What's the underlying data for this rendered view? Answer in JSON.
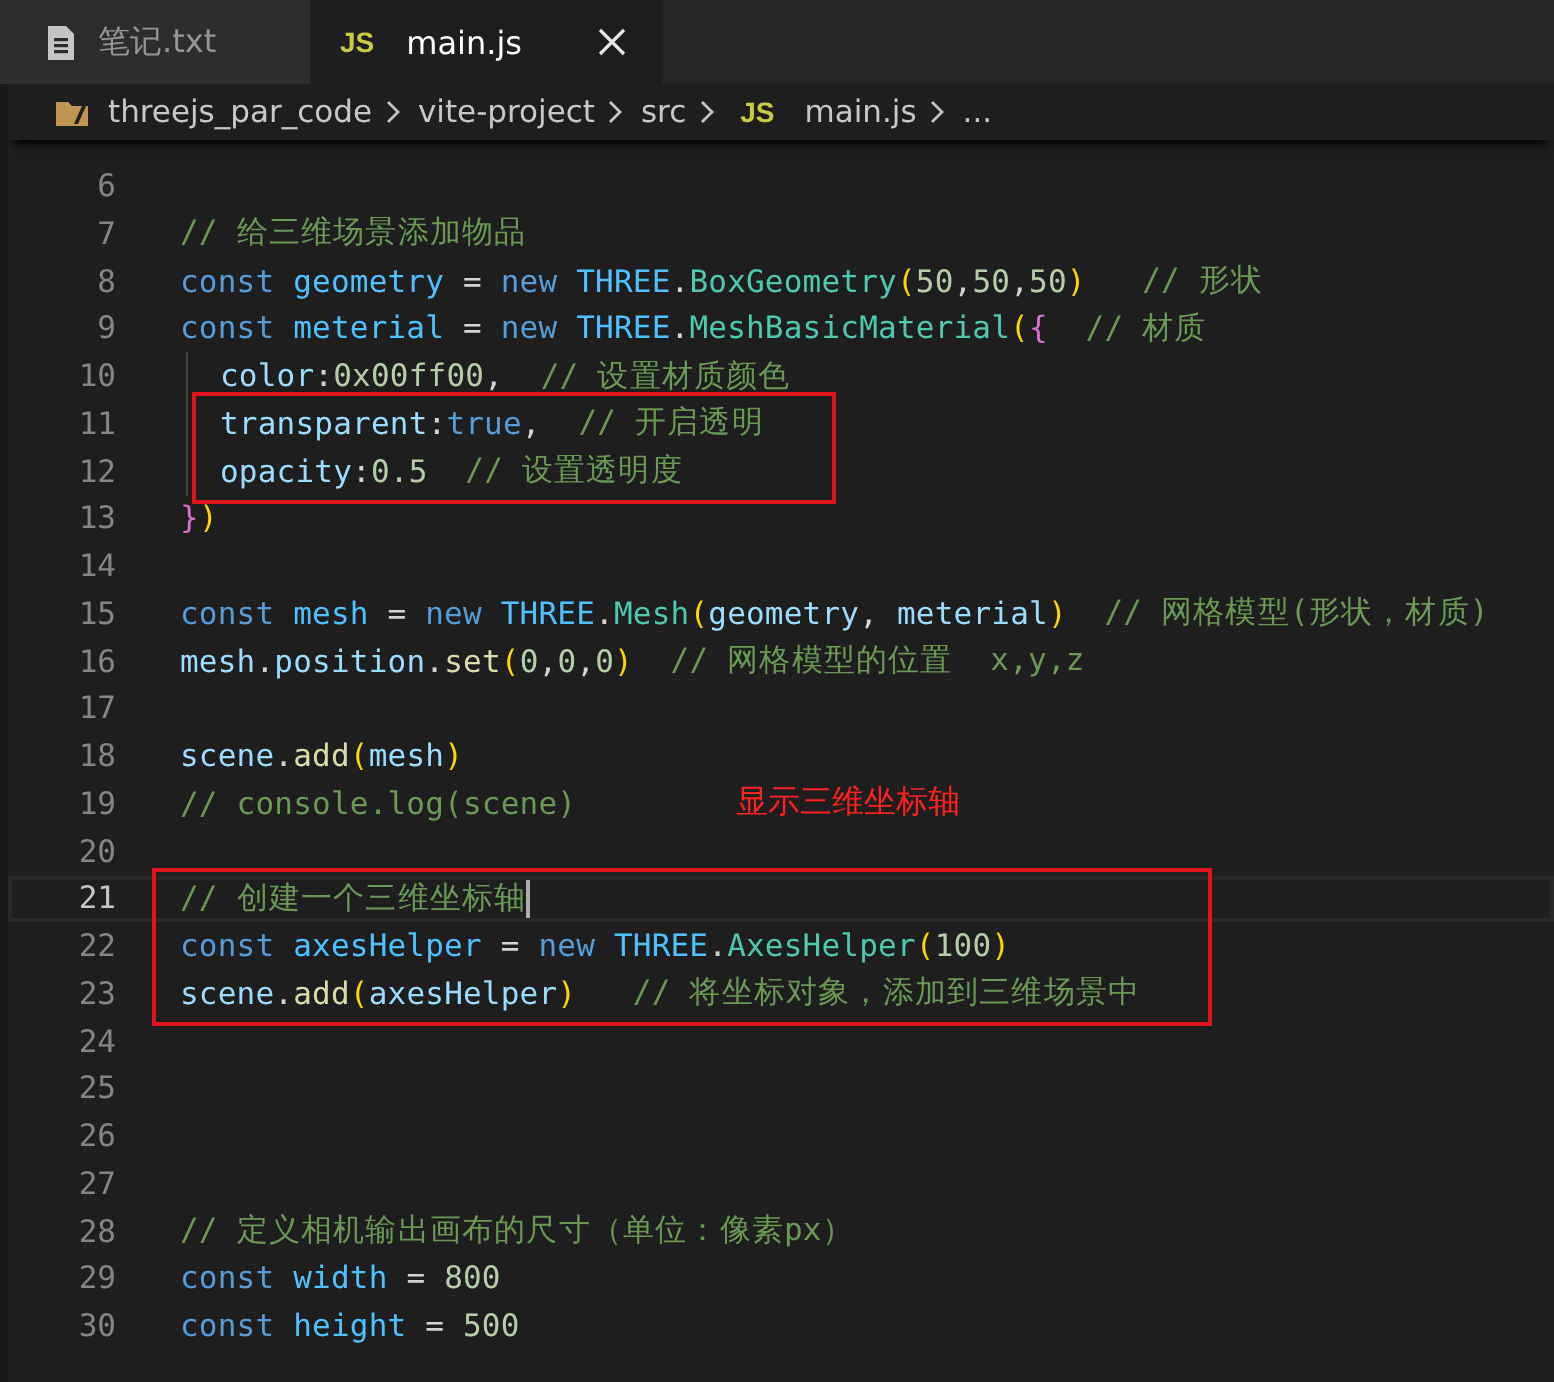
{
  "tabs": [
    {
      "kind": "text",
      "label": "笔记.txt",
      "selected": false
    },
    {
      "kind": "js",
      "badge": "JS",
      "label": "main.js",
      "selected": true
    }
  ],
  "breadcrumb": [
    {
      "kind": "folder",
      "label": "threejs_par_code"
    },
    {
      "kind": "plain",
      "label": "vite-project"
    },
    {
      "kind": "plain",
      "label": "src"
    },
    {
      "kind": "js",
      "badge": "JS",
      "label": "main.js"
    },
    {
      "kind": "plain",
      "label": "..."
    }
  ],
  "lines": [
    {
      "number": "6"
    },
    {
      "number": "7",
      "tokens": [
        {
          "kind": "cm",
          "text": "// 给三维场景添加物品"
        }
      ]
    },
    {
      "number": "8",
      "tokens": [
        {
          "kind": "kw",
          "text": "const "
        },
        {
          "kind": "const",
          "text": "geometry"
        },
        {
          "kind": "op",
          "text": " = "
        },
        {
          "kind": "kw",
          "text": "new "
        },
        {
          "kind": "const",
          "text": "THREE"
        },
        {
          "kind": "op",
          "text": "."
        },
        {
          "kind": "cls",
          "text": "BoxGeometry"
        },
        {
          "kind": "br1",
          "text": "("
        },
        {
          "kind": "num",
          "text": "50"
        },
        {
          "kind": "op",
          "text": ","
        },
        {
          "kind": "num",
          "text": "50"
        },
        {
          "kind": "op",
          "text": ","
        },
        {
          "kind": "num",
          "text": "50"
        },
        {
          "kind": "br1",
          "text": ")   "
        },
        {
          "kind": "cm",
          "text": "// 形状"
        }
      ]
    },
    {
      "number": "9",
      "tokens": [
        {
          "kind": "kw",
          "text": "const "
        },
        {
          "kind": "const",
          "text": "meterial"
        },
        {
          "kind": "op",
          "text": " = "
        },
        {
          "kind": "kw",
          "text": "new "
        },
        {
          "kind": "const",
          "text": "THREE"
        },
        {
          "kind": "op",
          "text": "."
        },
        {
          "kind": "cls",
          "text": "MeshBasicMaterial"
        },
        {
          "kind": "br1",
          "text": "("
        },
        {
          "kind": "br2",
          "text": "{  "
        },
        {
          "kind": "cm",
          "text": "// 材质"
        }
      ]
    },
    {
      "number": "10",
      "indent": true,
      "tokens": [
        {
          "kind": "var",
          "text": "color"
        },
        {
          "kind": "op",
          "text": ":"
        },
        {
          "kind": "num",
          "text": "0x00ff00"
        },
        {
          "kind": "op",
          "text": ",  "
        },
        {
          "kind": "cm",
          "text": "// 设置材质颜色"
        }
      ]
    },
    {
      "number": "11",
      "indent": true,
      "boxed": true,
      "tokens": [
        {
          "kind": "var",
          "text": "transparent"
        },
        {
          "kind": "op",
          "text": ":"
        },
        {
          "kind": "kw",
          "text": "true"
        },
        {
          "kind": "op",
          "text": ",  "
        },
        {
          "kind": "cm",
          "text": "// 开启透明"
        }
      ]
    },
    {
      "number": "12",
      "indent": true,
      "boxed": true,
      "tokens": [
        {
          "kind": "var",
          "text": "opacity"
        },
        {
          "kind": "op",
          "text": ":"
        },
        {
          "kind": "num",
          "text": "0.5  "
        },
        {
          "kind": "cm",
          "text": "// 设置透明度"
        }
      ]
    },
    {
      "number": "13",
      "tokens": [
        {
          "kind": "br2",
          "text": "}"
        },
        {
          "kind": "br1",
          "text": ")"
        }
      ]
    },
    {
      "number": "14"
    },
    {
      "number": "15",
      "tokens": [
        {
          "kind": "kw",
          "text": "const "
        },
        {
          "kind": "const",
          "text": "mesh"
        },
        {
          "kind": "op",
          "text": " = "
        },
        {
          "kind": "kw",
          "text": "new "
        },
        {
          "kind": "const",
          "text": "THREE"
        },
        {
          "kind": "op",
          "text": "."
        },
        {
          "kind": "cls",
          "text": "Mesh"
        },
        {
          "kind": "br1",
          "text": "("
        },
        {
          "kind": "var",
          "text": "geometry"
        },
        {
          "kind": "op",
          "text": ", "
        },
        {
          "kind": "var",
          "text": "meterial"
        },
        {
          "kind": "br1",
          "text": ")  "
        },
        {
          "kind": "cm",
          "text": "// 网格模型(形状，材质)"
        }
      ]
    },
    {
      "number": "16",
      "tokens": [
        {
          "kind": "var",
          "text": "mesh"
        },
        {
          "kind": "op",
          "text": "."
        },
        {
          "kind": "var",
          "text": "position"
        },
        {
          "kind": "op",
          "text": "."
        },
        {
          "kind": "fn",
          "text": "set"
        },
        {
          "kind": "br1",
          "text": "("
        },
        {
          "kind": "num",
          "text": "0"
        },
        {
          "kind": "op",
          "text": ","
        },
        {
          "kind": "num",
          "text": "0"
        },
        {
          "kind": "op",
          "text": ","
        },
        {
          "kind": "num",
          "text": "0"
        },
        {
          "kind": "br1",
          "text": ")  "
        },
        {
          "kind": "cm",
          "text": "// 网格模型的位置  x,y,z"
        }
      ]
    },
    {
      "number": "17"
    },
    {
      "number": "18",
      "tokens": [
        {
          "kind": "var",
          "text": "scene"
        },
        {
          "kind": "op",
          "text": "."
        },
        {
          "kind": "fn",
          "text": "add"
        },
        {
          "kind": "br1",
          "text": "("
        },
        {
          "kind": "var",
          "text": "mesh"
        },
        {
          "kind": "br1",
          "text": ")"
        }
      ]
    },
    {
      "number": "19",
      "note": "显示三维坐标轴",
      "tokens": [
        {
          "kind": "cm",
          "text": "// console.log(scene)"
        }
      ]
    },
    {
      "number": "20"
    },
    {
      "number": "21",
      "boxed": true,
      "current": true,
      "cursor": true,
      "tokens": [
        {
          "kind": "cm",
          "text": "// 创建一个三维坐标轴"
        }
      ]
    },
    {
      "number": "22",
      "boxed": true,
      "tokens": [
        {
          "kind": "kw",
          "text": "const "
        },
        {
          "kind": "const",
          "text": "axesHelper"
        },
        {
          "kind": "op",
          "text": " = "
        },
        {
          "kind": "kw",
          "text": "new "
        },
        {
          "kind": "const",
          "text": "THREE"
        },
        {
          "kind": "op",
          "text": "."
        },
        {
          "kind": "cls",
          "text": "AxesHelper"
        },
        {
          "kind": "br1",
          "text": "("
        },
        {
          "kind": "num",
          "text": "100"
        },
        {
          "kind": "br1",
          "text": ")"
        }
      ]
    },
    {
      "number": "23",
      "boxed": true,
      "tokens": [
        {
          "kind": "var",
          "text": "scene"
        },
        {
          "kind": "op",
          "text": "."
        },
        {
          "kind": "fn",
          "text": "add"
        },
        {
          "kind": "br1",
          "text": "("
        },
        {
          "kind": "var",
          "text": "axesHelper"
        },
        {
          "kind": "br1",
          "text": ")   "
        },
        {
          "kind": "cm",
          "text": "// 将坐标对象，添加到三维场景中"
        }
      ]
    },
    {
      "number": "24"
    },
    {
      "number": "25"
    },
    {
      "number": "26"
    },
    {
      "number": "27"
    },
    {
      "number": "28",
      "tokens": [
        {
          "kind": "cm",
          "text": "// 定义相机输出画布的尺寸（单位：像素px）"
        }
      ]
    },
    {
      "number": "29",
      "tokens": [
        {
          "kind": "kw",
          "text": "const "
        },
        {
          "kind": "const",
          "text": "width"
        },
        {
          "kind": "op",
          "text": " = "
        },
        {
          "kind": "num",
          "text": "800"
        }
      ]
    },
    {
      "number": "30",
      "tokens": [
        {
          "kind": "kw",
          "text": "const "
        },
        {
          "kind": "const",
          "text": "height"
        },
        {
          "kind": "op",
          "text": " = "
        },
        {
          "kind": "num",
          "text": "500"
        }
      ]
    }
  ]
}
